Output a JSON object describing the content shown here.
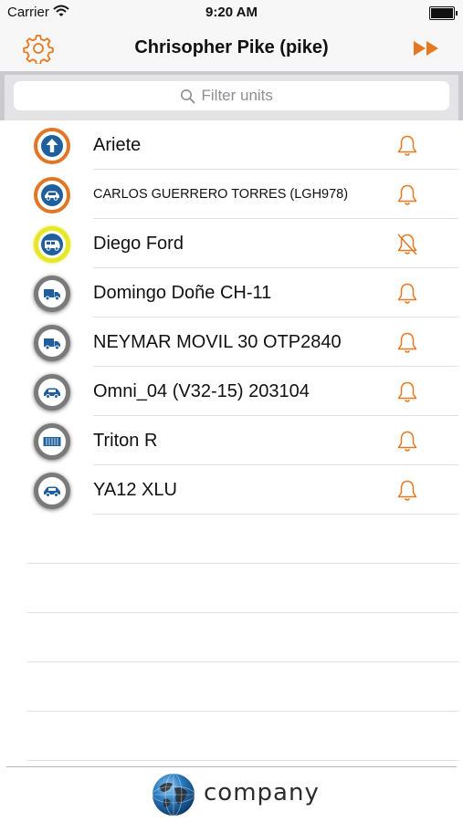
{
  "status_bar": {
    "carrier": "Carrier",
    "time": "9:20 AM"
  },
  "nav_bar": {
    "title": "Chrisopher Pike (pike)",
    "settings_icon": "gear-icon",
    "forward_icon": "fast-forward-icon"
  },
  "search": {
    "placeholder": "Filter units",
    "value": ""
  },
  "units": [
    {
      "name": "Ariete",
      "icon": "arrow-up-icon",
      "ring": "orange",
      "notifications": "on"
    },
    {
      "name": "CARLOS GUERRERO TORRES (LGH978)",
      "icon": "car-icon",
      "ring": "orange",
      "notifications": "on"
    },
    {
      "name": "Diego Ford",
      "icon": "van-icon",
      "ring": "yellow",
      "notifications": "off"
    },
    {
      "name": "Domingo Doñe CH-11",
      "icon": "truck-icon",
      "ring": "gray",
      "notifications": "on"
    },
    {
      "name": "NEYMAR MOVIL 30 OTP2840",
      "icon": "truck-icon",
      "ring": "gray",
      "notifications": "on"
    },
    {
      "name": "Omni_04 (V32-15) 203104",
      "icon": "car-icon",
      "ring": "gray",
      "notifications": "on"
    },
    {
      "name": "Triton R",
      "icon": "container-icon",
      "ring": "gray",
      "notifications": "on"
    },
    {
      "name": "YA12 XLU",
      "icon": "car-icon",
      "ring": "gray",
      "notifications": "on"
    }
  ],
  "footer": {
    "brand": "company"
  },
  "colors": {
    "accent": "#e8781f",
    "icon_blue": "#1f5f9e",
    "ring_orange": "#e17626",
    "ring_yellow": "#e5e82a",
    "ring_gray": "#7a7a7a"
  }
}
